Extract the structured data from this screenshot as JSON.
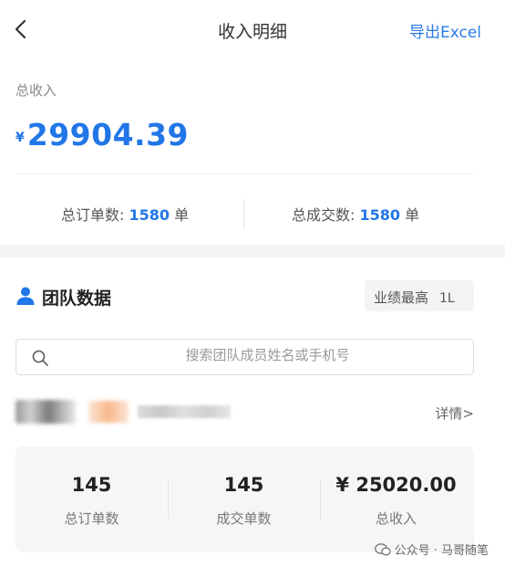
{
  "header": {
    "title": "收入明细",
    "export_label": "导出Excel"
  },
  "summary": {
    "total_income_label": "总收入",
    "currency": "¥",
    "total_income_value": "29904.39",
    "orders_label": "总订单数: ",
    "orders_value": "1580",
    "orders_unit": "单",
    "deals_label": "总成交数: ",
    "deals_value": "1580",
    "deals_unit": "单"
  },
  "team": {
    "title": "团队数据",
    "sort_label": "业绩最高",
    "sort_icon": "1L",
    "search_placeholder": "搜索团队成员姓名或手机号"
  },
  "member": {
    "detail_label": "详情>",
    "stats": [
      {
        "value": "145",
        "label": "总订单数"
      },
      {
        "value": "145",
        "label": "成交单数"
      },
      {
        "value": "¥ 25020.00",
        "label": "总收入"
      }
    ]
  },
  "watermark": {
    "text": "公众号 · 马哥随笔"
  },
  "colors": {
    "accent": "#2176e8",
    "link": "#2a7be6"
  },
  "icons": {
    "back": "chevron-left-icon",
    "user": "user-icon",
    "search": "search-icon",
    "wechat": "wechat-icon"
  }
}
